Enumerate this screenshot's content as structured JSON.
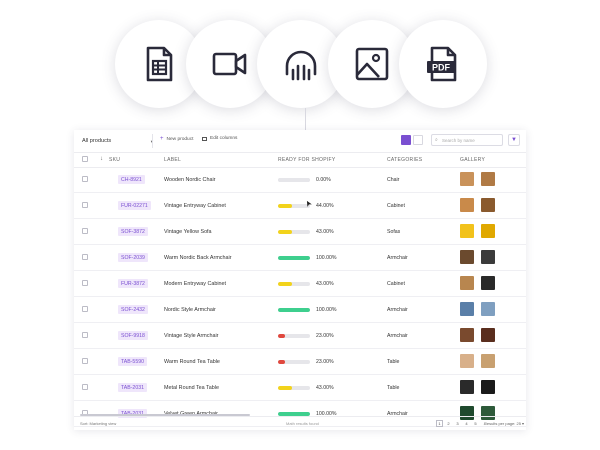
{
  "icons": [
    {
      "name": "spreadsheet-icon"
    },
    {
      "name": "video-icon"
    },
    {
      "name": "audio-icon"
    },
    {
      "name": "image-icon"
    },
    {
      "name": "pdf-file-icon",
      "text": "PDF"
    }
  ],
  "toolbar": {
    "select_value": "All products",
    "new_product": "New product",
    "edit_columns": "Edit columns",
    "search_placeholder": "Search by name"
  },
  "table": {
    "headers": {
      "sku": "SKU",
      "label": "Label",
      "ready": "Ready for Shopify",
      "categories": "Categories",
      "gallery": "Gallery"
    },
    "rows": [
      {
        "sku": "CH-8921",
        "label": "Wooden Nordic Chair",
        "percent": "0.00%",
        "ready": 0.0,
        "category": "Chair",
        "bar_color": "#cfcfd6"
      },
      {
        "sku": "FUR-02271",
        "label": "Vintage Entryway Cabinet",
        "percent": "44.00%",
        "ready": 0.44,
        "category": "Cabinet",
        "bar_color": "#f2d31b"
      },
      {
        "sku": "SOF-3872",
        "label": "Vintage Yellow Sofa",
        "percent": "43.00%",
        "ready": 0.43,
        "category": "Sofas",
        "bar_color": "#f2d31b"
      },
      {
        "sku": "SOF-2039",
        "label": "Warm Nordic Back Armchair",
        "percent": "100.00%",
        "ready": 1.0,
        "category": "Armchair",
        "bar_color": "#3ecf8e"
      },
      {
        "sku": "FUR-3872",
        "label": "Modern Entryway Cabinet",
        "percent": "43.00%",
        "ready": 0.43,
        "category": "Cabinet",
        "bar_color": "#f2d31b"
      },
      {
        "sku": "SOF-2432",
        "label": "Nordic Style Armchair",
        "percent": "100.00%",
        "ready": 1.0,
        "category": "Armchair",
        "bar_color": "#3ecf8e"
      },
      {
        "sku": "SOF-9918",
        "label": "Vintage Style Armchair",
        "percent": "23.00%",
        "ready": 0.23,
        "category": "Armchair",
        "bar_color": "#e0483e"
      },
      {
        "sku": "TAB-5590",
        "label": "Warm Round Tea Table",
        "percent": "23.00%",
        "ready": 0.23,
        "category": "Table",
        "bar_color": "#e0483e"
      },
      {
        "sku": "TAB-2031",
        "label": "Metal Round Tea Table",
        "percent": "43.00%",
        "ready": 0.43,
        "category": "Table",
        "bar_color": "#f2d31b"
      },
      {
        "sku": "TAB-2031",
        "label": "Velvet Green Armchair",
        "percent": "100.00%",
        "ready": 1.0,
        "category": "Armchair",
        "bar_color": "#3ecf8e"
      }
    ],
    "thumb_colors": [
      [
        "#c9925a",
        "#b07a45"
      ],
      [
        "#c98a4a",
        "#8a5a2e"
      ],
      [
        "#f2c21b",
        "#e0a800"
      ],
      [
        "#6b4a2e",
        "#3b3b3b"
      ],
      [
        "#b8864f",
        "#2a2a2a"
      ],
      [
        "#5a7fa8",
        "#7f9fc0"
      ],
      [
        "#7a4a2e",
        "#5a2e1e"
      ],
      [
        "#d8b08a",
        "#c8a070"
      ],
      [
        "#2a2a2a",
        "#1a1a1a"
      ],
      [
        "#1f4a2e",
        "#2e5a3a"
      ]
    ]
  },
  "footer": {
    "left": "Sort: Marketing view",
    "middle": "Math results found",
    "pages": [
      "1",
      "2",
      "3",
      "4",
      "5"
    ],
    "next": "→",
    "per_page": "Results per page: 25 ▾"
  }
}
